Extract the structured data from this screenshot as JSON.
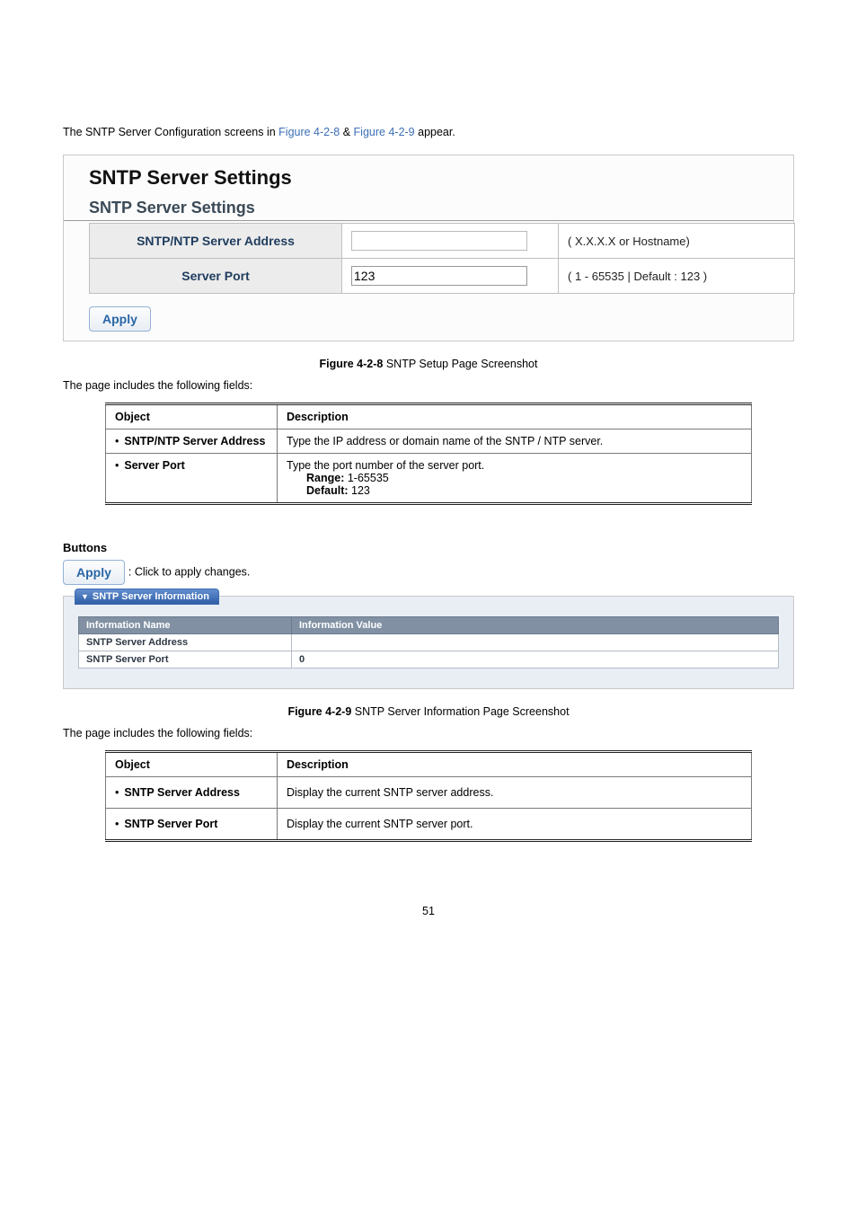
{
  "intro": {
    "pre": "The SNTP Server Configuration screens in ",
    "link1": "Figure 4-2-8",
    "amp": " & ",
    "link2": "Figure 4-2-9",
    "post": " appear."
  },
  "panel1": {
    "title": "SNTP Server Settings",
    "subtitle": "SNTP Server Settings",
    "rows": [
      {
        "label": "SNTP/NTP Server Address",
        "value": "",
        "hint": "( X.X.X.X or Hostname)"
      },
      {
        "label": "Server Port",
        "value": "123",
        "hint": "( 1 - 65535 | Default : 123 )"
      }
    ],
    "apply": "Apply"
  },
  "caption1_prefix": "Figure 4-2-8 ",
  "caption1_text": "SNTP Setup Page Screenshot",
  "lead1": "The page includes the following fields:",
  "desc1": {
    "headers": [
      "Object",
      "Description"
    ],
    "rows": [
      {
        "obj": "SNTP/NTP Server Address",
        "desc": "Type the IP address or domain name of the SNTP / NTP server."
      },
      {
        "obj": "Server Port",
        "desc": "Type the port number of the server port.",
        "extra": [
          {
            "label": "Range:",
            "value": " 1-65535"
          },
          {
            "label": "Default:",
            "value": " 123"
          }
        ]
      }
    ]
  },
  "buttons": {
    "heading": "Buttons",
    "apply_label": "Apply",
    "apply_text": ": Click to apply changes."
  },
  "panel2": {
    "tab": "SNTP Server Information",
    "headers": [
      "Information Name",
      "Information Value"
    ],
    "rows": [
      {
        "name": "SNTP Server Address",
        "value": ""
      },
      {
        "name": "SNTP Server Port",
        "value": "0"
      }
    ]
  },
  "caption2_prefix": "Figure 4-2-9 ",
  "caption2_text": "SNTP Server Information Page Screenshot",
  "lead2": "The page includes the following fields:",
  "desc2": {
    "headers": [
      "Object",
      "Description"
    ],
    "rows": [
      {
        "obj": "SNTP Server Address",
        "desc": "Display the current SNTP server address."
      },
      {
        "obj": "SNTP Server Port",
        "desc": "Display the current SNTP server port."
      }
    ]
  },
  "page_num": "51"
}
